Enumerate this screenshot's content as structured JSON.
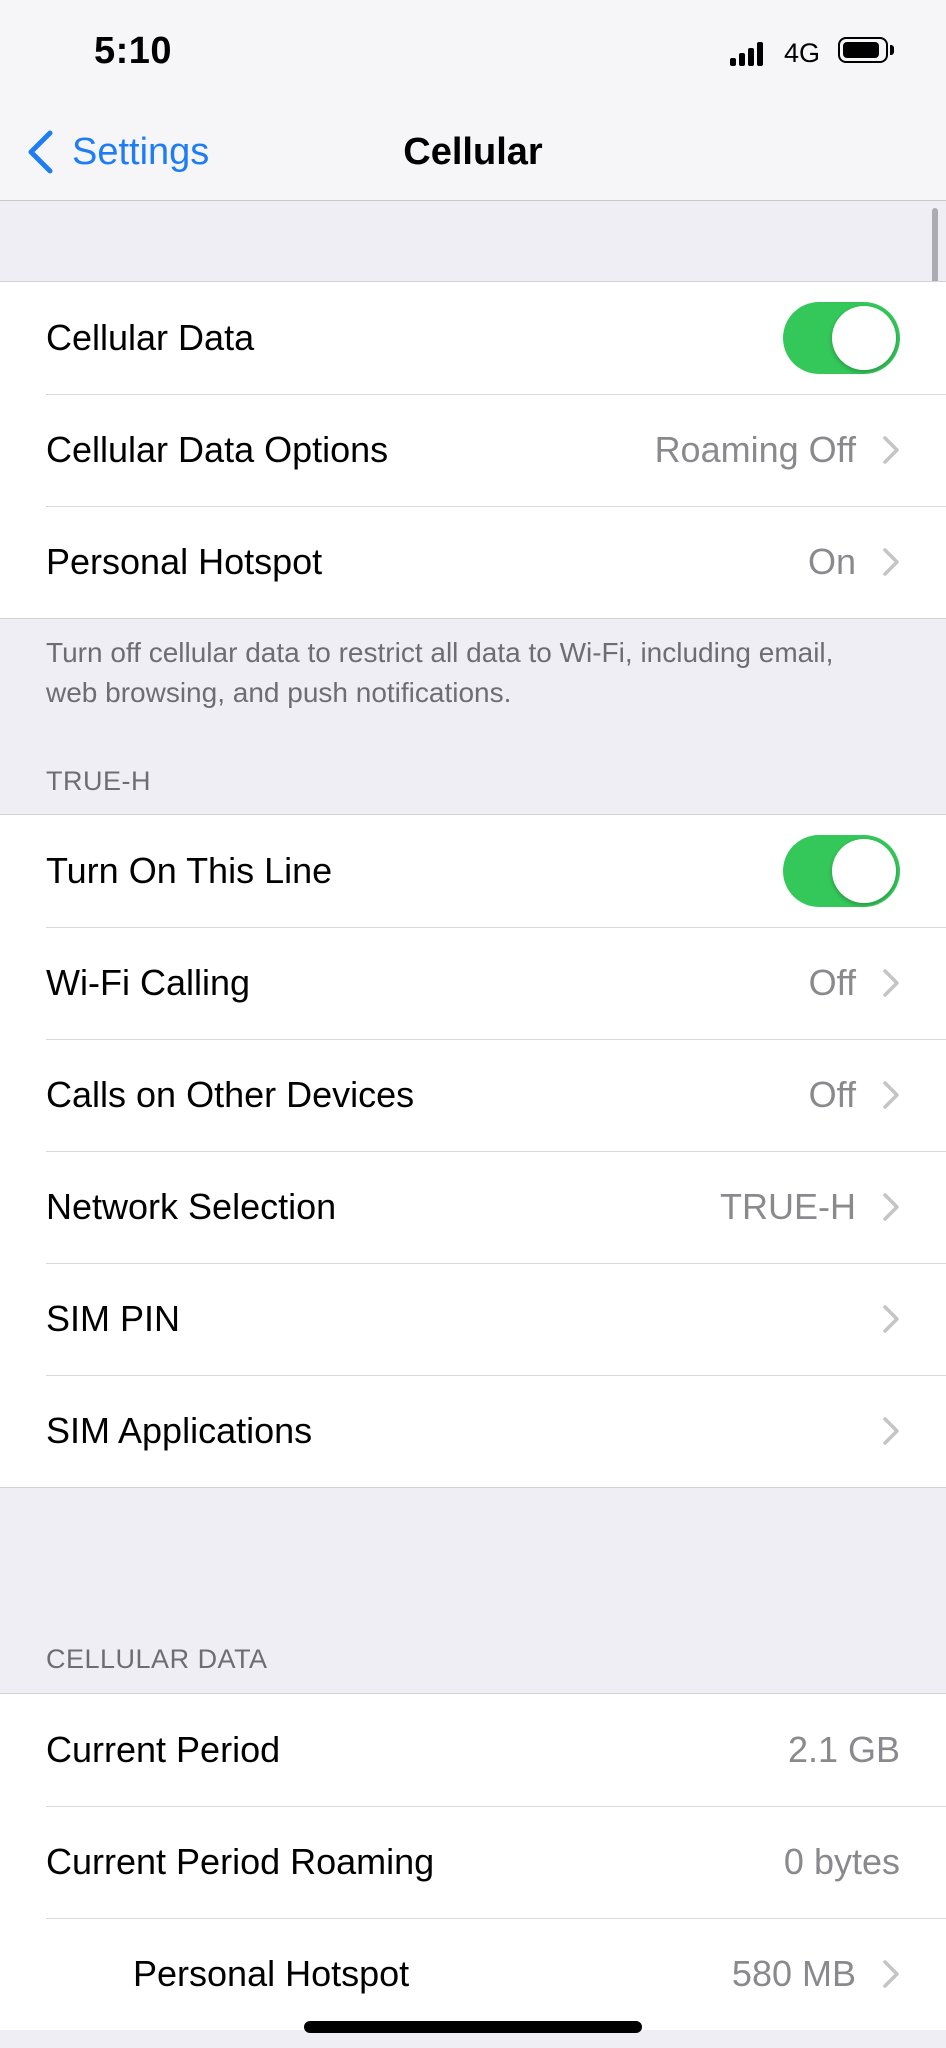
{
  "status_bar": {
    "time": "5:10",
    "network": "4G"
  },
  "nav": {
    "back_label": "Settings",
    "title": "Cellular"
  },
  "group1": {
    "cellular_data": {
      "label": "Cellular Data",
      "enabled": true
    },
    "cellular_data_options": {
      "label": "Cellular Data Options",
      "value": "Roaming Off"
    },
    "personal_hotspot": {
      "label": "Personal Hotspot",
      "value": "On"
    }
  },
  "group1_footer": "Turn off cellular data to restrict all data to Wi-Fi, including email, web browsing, and push notifications.",
  "line_section": {
    "header": "TRUE-H",
    "turn_on_line": {
      "label": "Turn On This Line",
      "enabled": true
    },
    "wifi_calling": {
      "label": "Wi-Fi Calling",
      "value": "Off"
    },
    "calls_other_devices": {
      "label": "Calls on Other Devices",
      "value": "Off"
    },
    "network_selection": {
      "label": "Network Selection",
      "value": "TRUE-H"
    },
    "sim_pin": {
      "label": "SIM PIN"
    },
    "sim_applications": {
      "label": "SIM Applications"
    }
  },
  "usage_section": {
    "header": "CELLULAR DATA",
    "current_period": {
      "label": "Current Period",
      "value": "2.1 GB"
    },
    "current_period_roaming": {
      "label": "Current Period Roaming",
      "value": "0 bytes"
    },
    "personal_hotspot": {
      "label": "Personal Hotspot",
      "value": "580 MB"
    }
  },
  "colors": {
    "accent": "#1f7df4",
    "toggle_on": "#34c759",
    "background": "#efeef4"
  }
}
